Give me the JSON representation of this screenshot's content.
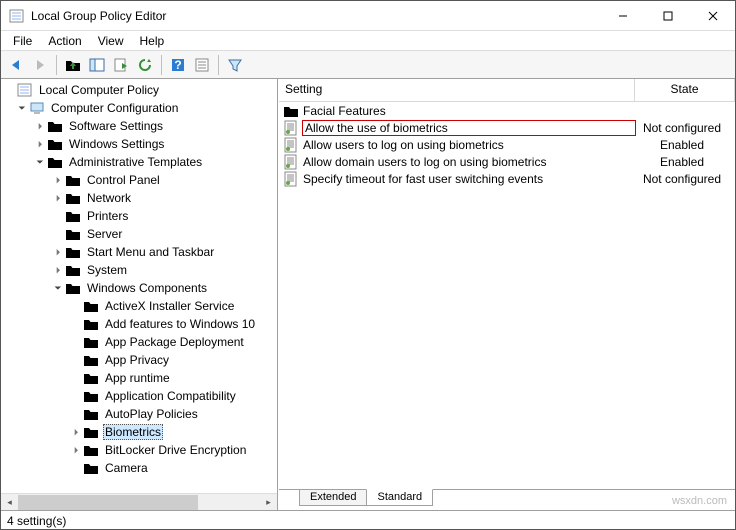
{
  "window": {
    "title": "Local Group Policy Editor"
  },
  "menu": [
    "File",
    "Action",
    "View",
    "Help"
  ],
  "tree": {
    "root": "Local Computer Policy",
    "cc": "Computer Configuration",
    "ss": "Software Settings",
    "ws": "Windows Settings",
    "at": "Administrative Templates",
    "cp": "Control Panel",
    "net": "Network",
    "prn": "Printers",
    "srv": "Server",
    "stm": "Start Menu and Taskbar",
    "sys": "System",
    "wc": "Windows Components",
    "axi": "ActiveX Installer Service",
    "af10": "Add features to Windows 10",
    "apd": "App Package Deployment",
    "apriv": "App Privacy",
    "art": "App runtime",
    "acomp": "Application Compatibility",
    "apol": "AutoPlay Policies",
    "bio": "Biometrics",
    "bde": "BitLocker Drive Encryption",
    "cam": "Camera"
  },
  "list": {
    "cols": {
      "setting": "Setting",
      "state": "State"
    },
    "rows": [
      {
        "type": "folder",
        "label": "Facial Features",
        "state": ""
      },
      {
        "type": "policy",
        "label": "Allow the use of biometrics",
        "state": "Not configured",
        "hl": true
      },
      {
        "type": "policy",
        "label": "Allow users to log on using biometrics",
        "state": "Enabled"
      },
      {
        "type": "policy",
        "label": "Allow domain users to log on using biometrics",
        "state": "Enabled"
      },
      {
        "type": "policy",
        "label": "Specify timeout for fast user switching events",
        "state": "Not configured"
      }
    ]
  },
  "tabs": {
    "extended": "Extended",
    "standard": "Standard"
  },
  "status": "4 setting(s)",
  "watermark": "wsxdn.com"
}
